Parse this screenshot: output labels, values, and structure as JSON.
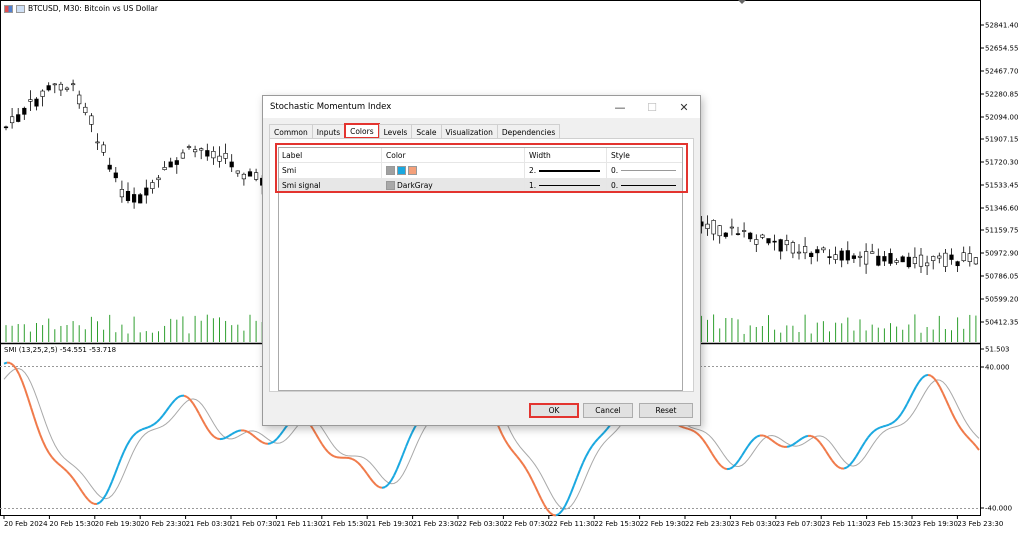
{
  "chart": {
    "title": "BTCUSD, M30:  Bitcoin vs US Dollar",
    "indicator_label": "SMI (13,25,2,5) -54.551 -53.718",
    "price_ticks": [
      "52841.40",
      "52654.55",
      "52467.70",
      "52280.85",
      "52094.00",
      "51907.15",
      "51720.30",
      "51533.45",
      "51346.60",
      "51159.75",
      "50972.90",
      "50786.05",
      "50599.20",
      "50412.35",
      "51.503"
    ],
    "indicator_ticks": [
      "40.000",
      "-40.000"
    ],
    "time_ticks": [
      "20 Feb 2024",
      "20 Feb 15:30",
      "20 Feb 19:30",
      "20 Feb 23:30",
      "21 Feb 03:30",
      "21 Feb 07:30",
      "21 Feb 11:30",
      "21 Feb 15:30",
      "21 Feb 19:30",
      "21 Feb 23:30",
      "22 Feb 03:30",
      "22 Feb 07:30",
      "22 Feb 11:30",
      "22 Feb 15:30",
      "22 Feb 19:30",
      "22 Feb 23:30",
      "23 Feb 03:30",
      "23 Feb 07:30",
      "23 Feb 11:30",
      "23 Feb 15:30",
      "23 Feb 19:30",
      "23 Feb 23:30"
    ],
    "colors": {
      "bull": "#ffffff",
      "bear": "#000000",
      "volume": "#2e9e2e",
      "smi_up": "#1aa8e0",
      "smi_down": "#f07a4a",
      "signal": "#a9a9a9"
    }
  },
  "dialog": {
    "title": "Stochastic Momentum Index",
    "minimize": "—",
    "maximize": "☐",
    "close": "✕",
    "tabs": [
      "Common",
      "Inputs",
      "Colors",
      "Levels",
      "Scale",
      "Visualization",
      "Dependencies"
    ],
    "active_tab": "Colors",
    "columns": [
      "Label",
      "Color",
      "Width",
      "Style"
    ],
    "rows": [
      {
        "label": "Smi",
        "colors": [
          "#a0a0a0",
          "#1aa8e0",
          "#f4a07a"
        ],
        "color_name": "",
        "width": "2.",
        "style": "0."
      },
      {
        "label": "Smi signal",
        "colors": [
          "#a9a9a9"
        ],
        "color_name": "DarkGray",
        "width": "1.",
        "style": "0."
      }
    ],
    "buttons": {
      "ok": "OK",
      "cancel": "Cancel",
      "reset": "Reset"
    }
  }
}
